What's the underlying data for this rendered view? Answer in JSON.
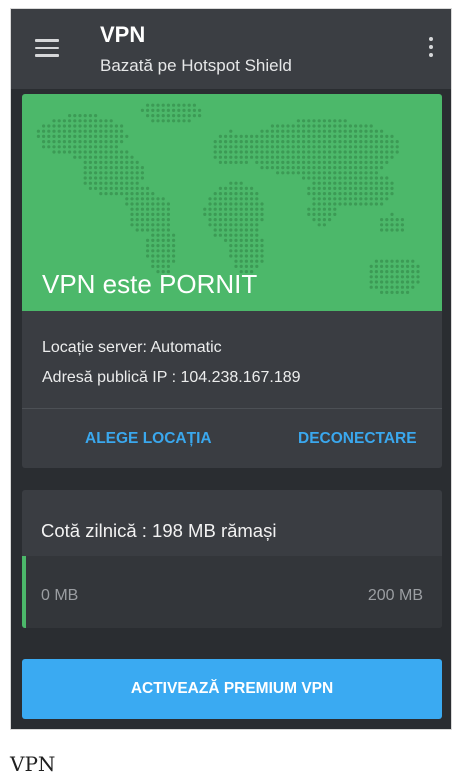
{
  "app": {
    "title": "VPN",
    "subtitle": "Bazată pe Hotspot Shield"
  },
  "status": {
    "state_text": "VPN este PORNIT",
    "server_location": "Locație server: Automatic",
    "public_ip": "Adresă publică IP : 104.238.167.189",
    "choose_location_label": "ALEGE LOCAȚIA",
    "disconnect_label": "DECONECTARE"
  },
  "quota": {
    "title": "Cotă zilnică : 198 MB rămași",
    "min_label": "0 MB",
    "max_label": "200 MB",
    "used_fraction": 0.01
  },
  "premium": {
    "label": "ACTIVEAZĂ PREMIUM VPN"
  },
  "caption": "VPN",
  "colors": {
    "map_green": "#4cb86a",
    "accent_blue": "#3aa8ee",
    "card_bg": "#3a3d42",
    "app_bar": "#3b3e43"
  },
  "icons": {
    "menu": "menu-icon",
    "overflow": "more-vertical-icon",
    "map": "world-map-icon"
  }
}
